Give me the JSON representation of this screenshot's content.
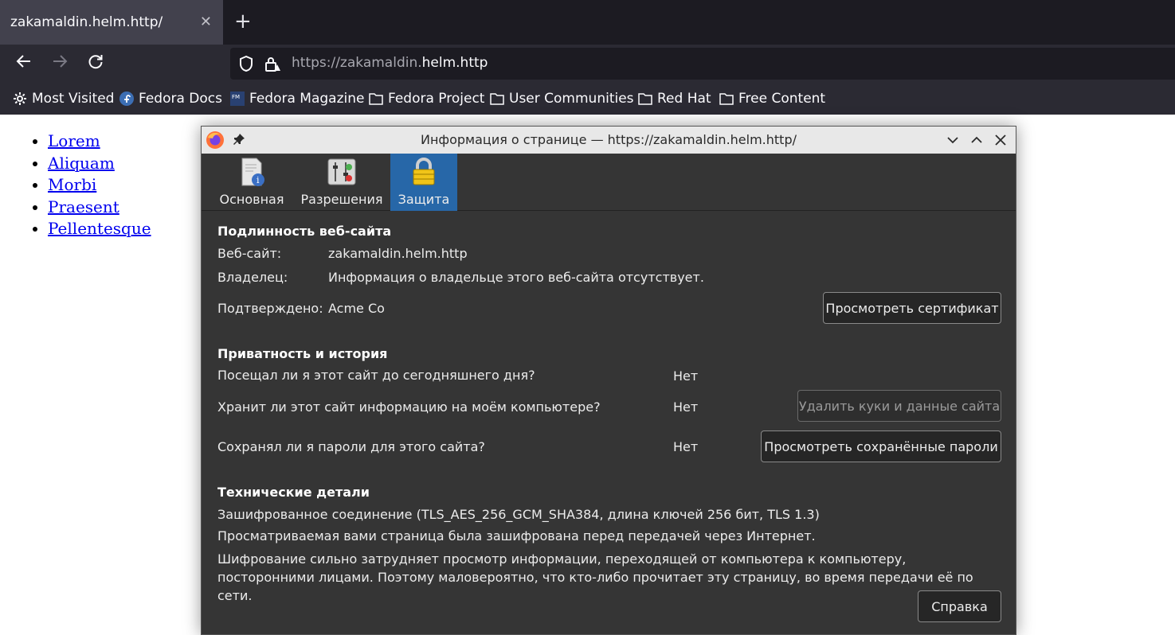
{
  "browser": {
    "tab_title": "zakamaldin.helm.http/",
    "url_prefix": "https://zakamaldin.",
    "url_domain": "helm.http",
    "bookmarks": [
      {
        "label": "Most Visited",
        "icon": "gear-icon"
      },
      {
        "label": "Fedora Docs",
        "icon": "fedora-icon"
      },
      {
        "label": "Fedora Magazine",
        "icon": "fedora-magazine-icon"
      },
      {
        "label": "Fedora Project",
        "icon": "folder-icon"
      },
      {
        "label": "User Communities",
        "icon": "folder-icon"
      },
      {
        "label": "Red Hat",
        "icon": "folder-icon"
      },
      {
        "label": "Free Content",
        "icon": "folder-icon"
      }
    ]
  },
  "page": {
    "links": [
      "Lorem",
      "Aliquam",
      "Morbi",
      "Praesent",
      "Pellentesque"
    ]
  },
  "dialog": {
    "title": "Информация о странице — https://zakamaldin.helm.http/",
    "tabs": [
      {
        "label": "Основная",
        "icon": "page-info-icon"
      },
      {
        "label": "Разрешения",
        "icon": "permissions-icon"
      },
      {
        "label": "Защита",
        "icon": "padlock-icon",
        "active": true
      }
    ],
    "identity": {
      "heading": "Подлинность веб-сайта",
      "website_label": "Веб-сайт:",
      "website_value": "zakamaldin.helm.http",
      "owner_label": "Владелец:",
      "owner_value": "Информация о владельце этого веб-сайта отсутствует.",
      "verified_label": "Подтверждено:",
      "verified_value": "Acme Co",
      "view_cert_button": "Просмотреть сертификат"
    },
    "privacy": {
      "heading": "Приватность и история",
      "q1": "Посещал ли я этот сайт до сегодняшнего дня?",
      "a1": "Нет",
      "q2": "Хранит ли этот сайт информацию на моём компьютере?",
      "a2": "Нет",
      "clear_button": "Удалить куки и данные сайта",
      "q3": "Сохранял ли я пароли для этого сайта?",
      "a3": "Нет",
      "passwords_button": "Просмотреть сохранённые пароли"
    },
    "technical": {
      "heading": "Технические детали",
      "line1": "Зашифрованное соединение (TLS_AES_256_GCM_SHA384, длина ключей 256 бит, TLS 1.3)",
      "line2": "Просматриваемая вами страница была зашифрована перед передачей через Интернет.",
      "line3": "Шифрование сильно затрудняет просмотр информации, переходящей от компьютера к компьютеру, посторонними лицами. Поэтому маловероятно, что кто-либо прочитает эту страницу, во время передачи её по сети.",
      "help_button": "Справка"
    }
  }
}
